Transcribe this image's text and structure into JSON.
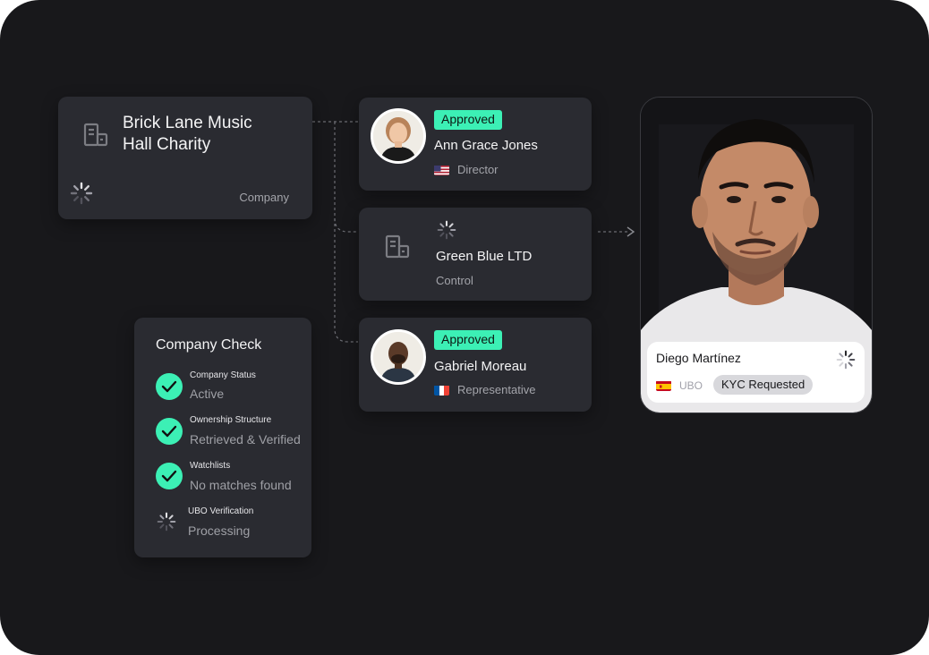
{
  "company": {
    "name_line1": "Brick Lane Music",
    "name_line2": "Hall Charity",
    "type": "Company",
    "icon": "building-icon"
  },
  "entities": [
    {
      "badge": "Approved",
      "name": "Ann Grace Jones",
      "role": "Director",
      "flag": "us-flag-icon"
    },
    {
      "name": "Green Blue LTD",
      "role": "Control",
      "icon": "building-icon"
    },
    {
      "badge": "Approved",
      "name": "Gabriel Moreau",
      "role": "Representative",
      "flag": "fr-flag-icon"
    }
  ],
  "company_check": {
    "title": "Company Check",
    "items": [
      {
        "label": "Company Status",
        "value": "Active",
        "status": "done"
      },
      {
        "label": "Ownership Structure",
        "value": "Retrieved & Verified",
        "status": "done"
      },
      {
        "label": "Watchlists",
        "value": "No matches found",
        "status": "done"
      },
      {
        "label": "UBO Verification",
        "value": "Processing",
        "status": "loading"
      }
    ]
  },
  "ubo_card": {
    "name": "Diego Martínez",
    "role": "UBO",
    "status": "KYC Requested",
    "flag": "es-flag-icon"
  },
  "colors": {
    "background": "#18181b",
    "card": "#2a2b31",
    "accent": "#3cf0b5"
  }
}
